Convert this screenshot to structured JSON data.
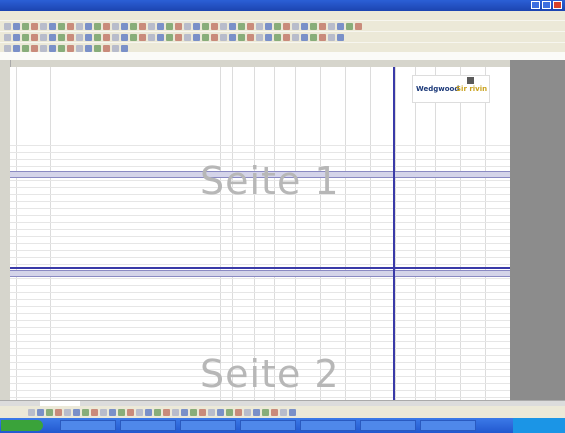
{
  "window": {
    "title": "",
    "controls": [
      "minimize",
      "maximize",
      "close"
    ]
  },
  "document": {
    "title": "",
    "logo_text_1": "Wedgwood",
    "logo_text_2": "Sir rivin"
  },
  "watermarks": [
    "Seite 1",
    "Seite 2"
  ],
  "colors": {
    "titlebar": "#2b5fd6",
    "section_band": "#d4d4e9",
    "page_break": "#3a3aa8",
    "start_button": "#3aa33a",
    "taskbar": "#2258cf",
    "tray": "#1b95e6"
  }
}
